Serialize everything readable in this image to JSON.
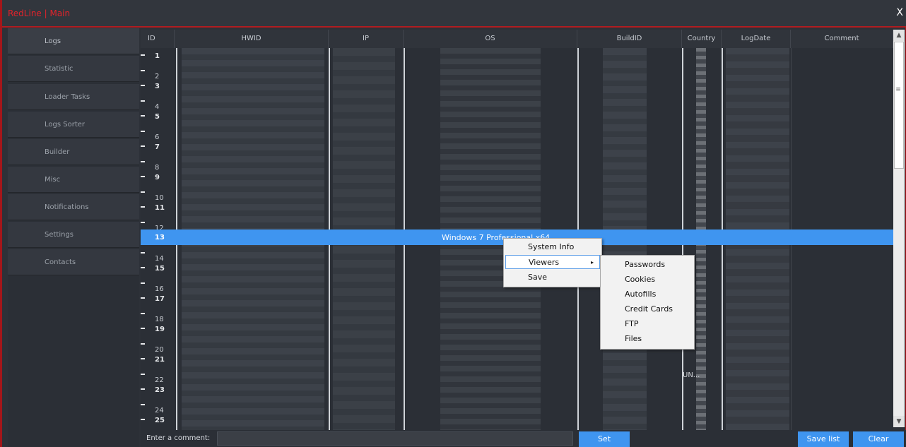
{
  "window": {
    "title": "RedLine | Main",
    "close_label": "X"
  },
  "sidebar": {
    "items": [
      {
        "label": "Logs"
      },
      {
        "label": "Statistic"
      },
      {
        "label": "Loader Tasks"
      },
      {
        "label": "Logs Sorter"
      },
      {
        "label": "Builder"
      },
      {
        "label": "Misc"
      },
      {
        "label": "Notifications"
      },
      {
        "label": "Settings"
      },
      {
        "label": "Contacts"
      }
    ]
  },
  "table": {
    "columns": [
      {
        "label": "ID"
      },
      {
        "label": "HWID"
      },
      {
        "label": "IP"
      },
      {
        "label": "OS"
      },
      {
        "label": "BuildID"
      },
      {
        "label": "Country"
      },
      {
        "label": "LogDate"
      },
      {
        "label": "Comment"
      }
    ],
    "row_ids": [
      "1",
      "2",
      "3",
      "4",
      "5",
      "6",
      "7",
      "8",
      "9",
      "10",
      "11",
      "12",
      "13",
      "14",
      "15",
      "16",
      "17",
      "18",
      "19",
      "20",
      "21",
      "22",
      "23",
      "24",
      "25"
    ],
    "selected": {
      "id": "13",
      "os": "Windows 7 Professional x64"
    },
    "country_fragment": "UN..."
  },
  "context_menu": {
    "items": [
      {
        "label": "System Info"
      },
      {
        "label": "Viewers"
      },
      {
        "label": "Save"
      }
    ],
    "submenu_arrow": "▸"
  },
  "viewers_submenu": {
    "items": [
      {
        "label": "Passwords"
      },
      {
        "label": "Cookies"
      },
      {
        "label": "Autofills"
      },
      {
        "label": "Credit Cards"
      },
      {
        "label": "FTP"
      },
      {
        "label": "Files"
      }
    ]
  },
  "scrollbar": {
    "up": "▲",
    "down": "▼",
    "grip": "≡"
  },
  "footer": {
    "comment_label": "Enter a comment:",
    "comment_value": "",
    "set_label": "Set",
    "save_list_label": "Save list",
    "clear_label": "Clear"
  },
  "colors": {
    "accent": "#3f95f0",
    "brand_red": "#e2232b",
    "border_red": "#a4161a"
  }
}
